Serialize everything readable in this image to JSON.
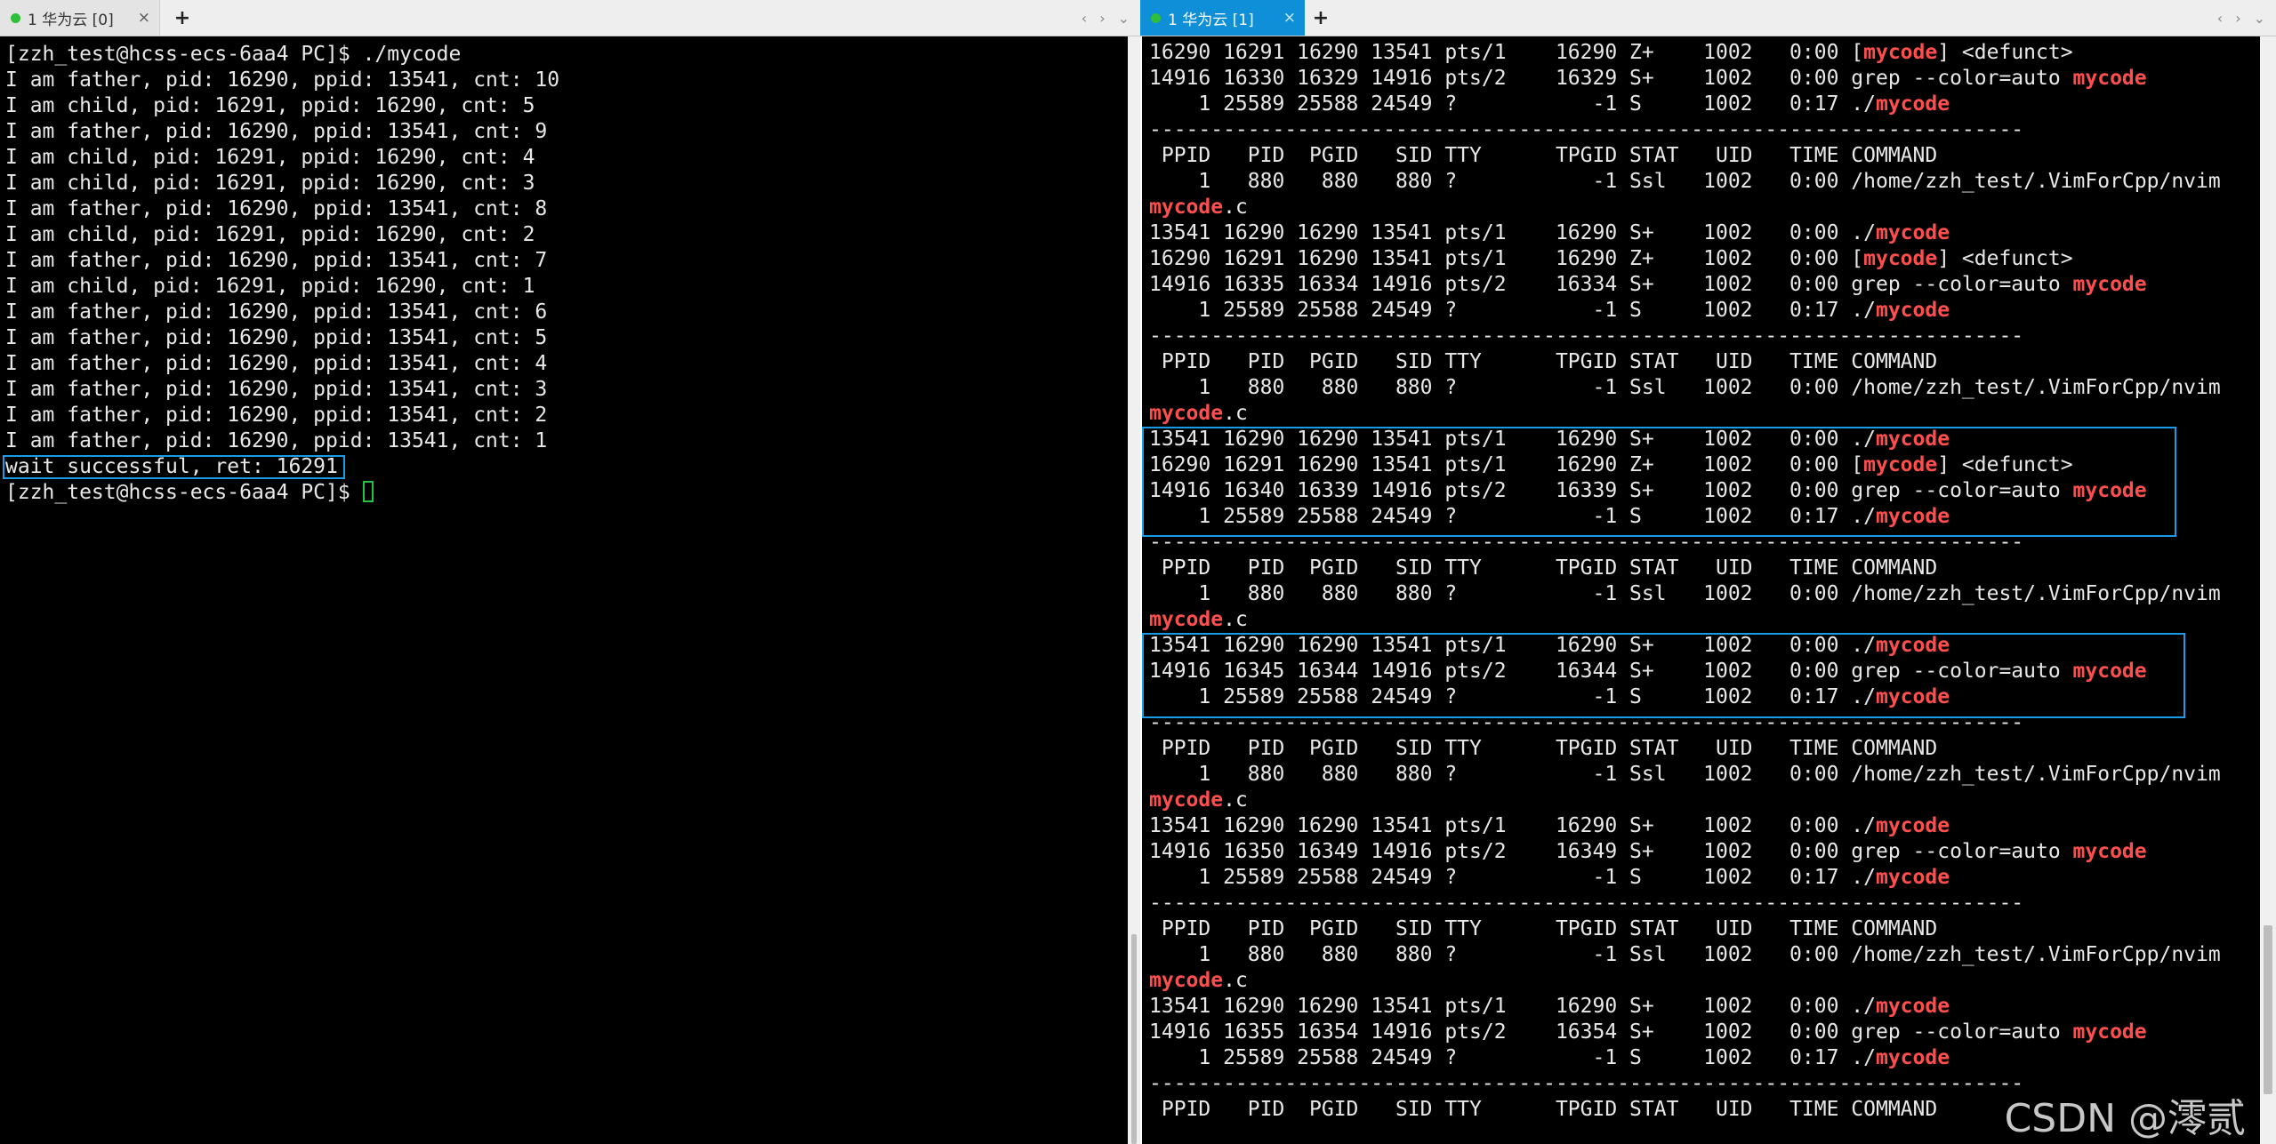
{
  "left_tab": {
    "label": "1 华为云 [0]",
    "close": "×",
    "add": "+"
  },
  "right_tab": {
    "label": "1 华为云 [1]",
    "close": "×",
    "add": "+"
  },
  "nav": {
    "prev": "‹",
    "next": "›",
    "menu": "⌄"
  },
  "left_terminal": {
    "lines": [
      "[zzh_test@hcss-ecs-6aa4 PC]$ ./mycode",
      "I am father, pid: 16290, ppid: 13541, cnt: 10",
      "I am child, pid: 16291, ppid: 16290, cnt: 5",
      "I am father, pid: 16290, ppid: 13541, cnt: 9",
      "I am child, pid: 16291, ppid: 16290, cnt: 4",
      "I am child, pid: 16291, ppid: 16290, cnt: 3",
      "I am father, pid: 16290, ppid: 13541, cnt: 8",
      "I am child, pid: 16291, ppid: 16290, cnt: 2",
      "I am father, pid: 16290, ppid: 13541, cnt: 7",
      "I am child, pid: 16291, ppid: 16290, cnt: 1",
      "I am father, pid: 16290, ppid: 13541, cnt: 6",
      "I am father, pid: 16290, ppid: 13541, cnt: 5",
      "I am father, pid: 16290, ppid: 13541, cnt: 4",
      "I am father, pid: 16290, ppid: 13541, cnt: 3",
      "I am father, pid: 16290, ppid: 13541, cnt: 2",
      "I am father, pid: 16290, ppid: 13541, cnt: 1",
      "wait successful, ret: 16291",
      "[zzh_test@hcss-ecs-6aa4 PC]$ "
    ]
  },
  "right_terminal": {
    "lines": [
      [
        [
          "16290 16291 16290 13541 pts/1    16290 Z+    1002   0:00 [",
          ""
        ],
        [
          "mycode",
          "r"
        ],
        [
          "] <defunct>",
          ""
        ]
      ],
      [
        [
          "14916 16330 16329 14916 pts/2    16329 S+    1002   0:00 grep --color=auto ",
          ""
        ],
        [
          "mycode",
          "r"
        ]
      ],
      [
        [
          "    1 25589 25588 24549 ?           -1 S     1002   0:17 ./",
          ""
        ],
        [
          "mycode",
          "r"
        ]
      ],
      [
        [
          "-----------------------------------------------------------------------",
          ""
        ]
      ],
      [
        [
          " PPID   PID  PGID   SID TTY      TPGID STAT   UID   TIME COMMAND",
          ""
        ]
      ],
      [
        [
          "    1   880   880   880 ?           -1 Ssl   1002   0:00 /home/zzh_test/.VimForCpp/nvim",
          ""
        ]
      ],
      [
        [
          "mycode",
          "r"
        ],
        [
          ".c",
          ""
        ]
      ],
      [
        [
          "13541 16290 16290 13541 pts/1    16290 S+    1002   0:00 ./",
          ""
        ],
        [
          "mycode",
          "r"
        ]
      ],
      [
        [
          "16290 16291 16290 13541 pts/1    16290 Z+    1002   0:00 [",
          ""
        ],
        [
          "mycode",
          "r"
        ],
        [
          "] <defunct>",
          ""
        ]
      ],
      [
        [
          "14916 16335 16334 14916 pts/2    16334 S+    1002   0:00 grep --color=auto ",
          ""
        ],
        [
          "mycode",
          "r"
        ]
      ],
      [
        [
          "    1 25589 25588 24549 ?           -1 S     1002   0:17 ./",
          ""
        ],
        [
          "mycode",
          "r"
        ]
      ],
      [
        [
          "-----------------------------------------------------------------------",
          ""
        ]
      ],
      [
        [
          " PPID   PID  PGID   SID TTY      TPGID STAT   UID   TIME COMMAND",
          ""
        ]
      ],
      [
        [
          "    1   880   880   880 ?           -1 Ssl   1002   0:00 /home/zzh_test/.VimForCpp/nvim",
          ""
        ]
      ],
      [
        [
          "mycode",
          "r"
        ],
        [
          ".c",
          ""
        ]
      ],
      [
        [
          "13541 16290 16290 13541 pts/1    16290 S+    1002   0:00 ./",
          ""
        ],
        [
          "mycode",
          "r"
        ]
      ],
      [
        [
          "16290 16291 16290 13541 pts/1    16290 Z+    1002   0:00 [",
          ""
        ],
        [
          "mycode",
          "r"
        ],
        [
          "] <defunct>",
          ""
        ]
      ],
      [
        [
          "14916 16340 16339 14916 pts/2    16339 S+    1002   0:00 grep --color=auto ",
          ""
        ],
        [
          "mycode",
          "r"
        ]
      ],
      [
        [
          "    1 25589 25588 24549 ?           -1 S     1002   0:17 ./",
          ""
        ],
        [
          "mycode",
          "r"
        ]
      ],
      [
        [
          "-----------------------------------------------------------------------",
          ""
        ]
      ],
      [
        [
          " PPID   PID  PGID   SID TTY      TPGID STAT   UID   TIME COMMAND",
          ""
        ]
      ],
      [
        [
          "    1   880   880   880 ?           -1 Ssl   1002   0:00 /home/zzh_test/.VimForCpp/nvim",
          ""
        ]
      ],
      [
        [
          "mycode",
          "r"
        ],
        [
          ".c",
          ""
        ]
      ],
      [
        [
          "13541 16290 16290 13541 pts/1    16290 S+    1002   0:00 ./",
          ""
        ],
        [
          "mycode",
          "r"
        ]
      ],
      [
        [
          "14916 16345 16344 14916 pts/2    16344 S+    1002   0:00 grep --color=auto ",
          ""
        ],
        [
          "mycode",
          "r"
        ]
      ],
      [
        [
          "    1 25589 25588 24549 ?           -1 S     1002   0:17 ./",
          ""
        ],
        [
          "mycode",
          "r"
        ]
      ],
      [
        [
          "-----------------------------------------------------------------------",
          ""
        ]
      ],
      [
        [
          " PPID   PID  PGID   SID TTY      TPGID STAT   UID   TIME COMMAND",
          ""
        ]
      ],
      [
        [
          "    1   880   880   880 ?           -1 Ssl   1002   0:00 /home/zzh_test/.VimForCpp/nvim",
          ""
        ]
      ],
      [
        [
          "mycode",
          "r"
        ],
        [
          ".c",
          ""
        ]
      ],
      [
        [
          "13541 16290 16290 13541 pts/1    16290 S+    1002   0:00 ./",
          ""
        ],
        [
          "mycode",
          "r"
        ]
      ],
      [
        [
          "14916 16350 16349 14916 pts/2    16349 S+    1002   0:00 grep --color=auto ",
          ""
        ],
        [
          "mycode",
          "r"
        ]
      ],
      [
        [
          "    1 25589 25588 24549 ?           -1 S     1002   0:17 ./",
          ""
        ],
        [
          "mycode",
          "r"
        ]
      ],
      [
        [
          "-----------------------------------------------------------------------",
          ""
        ]
      ],
      [
        [
          " PPID   PID  PGID   SID TTY      TPGID STAT   UID   TIME COMMAND",
          ""
        ]
      ],
      [
        [
          "    1   880   880   880 ?           -1 Ssl   1002   0:00 /home/zzh_test/.VimForCpp/nvim",
          ""
        ]
      ],
      [
        [
          "mycode",
          "r"
        ],
        [
          ".c",
          ""
        ]
      ],
      [
        [
          "13541 16290 16290 13541 pts/1    16290 S+    1002   0:00 ./",
          ""
        ],
        [
          "mycode",
          "r"
        ]
      ],
      [
        [
          "14916 16355 16354 14916 pts/2    16354 S+    1002   0:00 grep --color=auto ",
          ""
        ],
        [
          "mycode",
          "r"
        ]
      ],
      [
        [
          "    1 25589 25588 24549 ?           -1 S     1002   0:17 ./",
          ""
        ],
        [
          "mycode",
          "r"
        ]
      ],
      [
        [
          "-----------------------------------------------------------------------",
          ""
        ]
      ],
      [
        [
          " PPID   PID  PGID   SID TTY      TPGID STAT   UID   TIME COMMAND",
          ""
        ]
      ]
    ]
  },
  "watermark": "CSDN @澪贰",
  "colors": {
    "terminal_bg": "#000000",
    "terminal_fg": "#e8e8e8",
    "highlight": "#ff4e4e",
    "box": "#1a9be6",
    "active_tab": "#0f8fd7",
    "cursor": "#24c33d"
  }
}
